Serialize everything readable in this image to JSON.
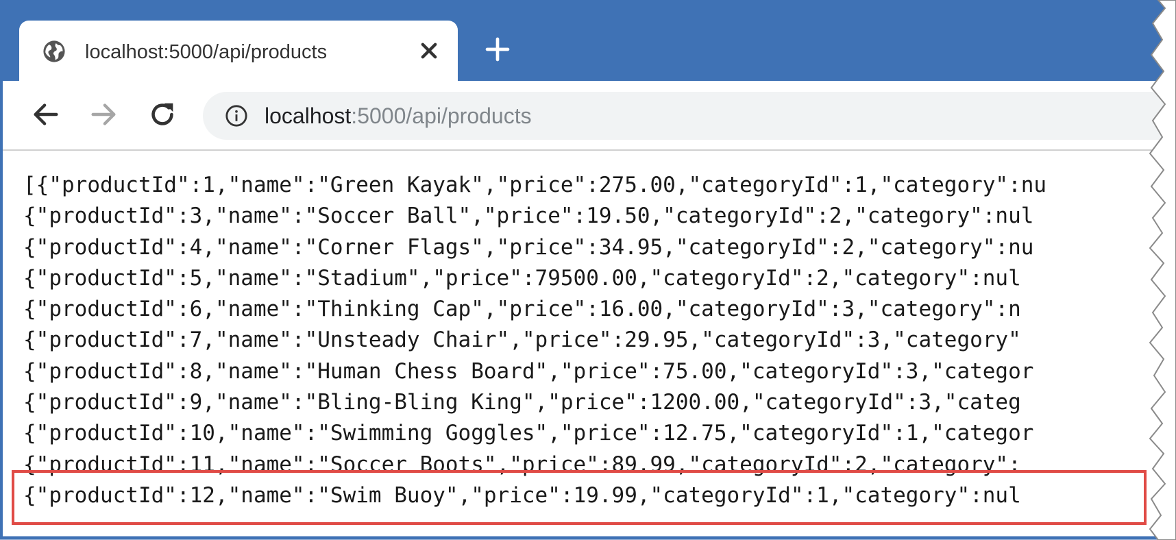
{
  "browser": {
    "tab": {
      "title": "localhost:5000/api/products",
      "icon": "globe-icon"
    },
    "address": {
      "host": "localhost",
      "rest": ":5000/api/products"
    },
    "colors": {
      "frame": "#3f72b5",
      "highlight": "#e04b46"
    }
  },
  "response": {
    "lines": [
      "[{\"productId\":1,\"name\":\"Green Kayak\",\"price\":275.00,\"categoryId\":1,\"category\":nu",
      "{\"productId\":3,\"name\":\"Soccer Ball\",\"price\":19.50,\"categoryId\":2,\"category\":nul",
      "{\"productId\":4,\"name\":\"Corner Flags\",\"price\":34.95,\"categoryId\":2,\"category\":nu",
      "{\"productId\":5,\"name\":\"Stadium\",\"price\":79500.00,\"categoryId\":2,\"category\":nul",
      "{\"productId\":6,\"name\":\"Thinking Cap\",\"price\":16.00,\"categoryId\":3,\"category\":n",
      "{\"productId\":7,\"name\":\"Unsteady Chair\",\"price\":29.95,\"categoryId\":3,\"category\"",
      "{\"productId\":8,\"name\":\"Human Chess Board\",\"price\":75.00,\"categoryId\":3,\"categor",
      "{\"productId\":9,\"name\":\"Bling-Bling King\",\"price\":1200.00,\"categoryId\":3,\"categ",
      "{\"productId\":10,\"name\":\"Swimming Goggles\",\"price\":12.75,\"categoryId\":1,\"categor",
      "{\"productId\":11,\"name\":\"Soccer Boots\",\"price\":89.99,\"categoryId\":2,\"category\":",
      "{\"productId\":12,\"name\":\"Swim Buoy\",\"price\":19.99,\"categoryId\":1,\"category\":nul"
    ],
    "highlighted_line": "{\"productId\":12,\"name\":\"Swim Buoy\",\"price\":19.99,\"categoryId\":1,\"category\":nul"
  }
}
